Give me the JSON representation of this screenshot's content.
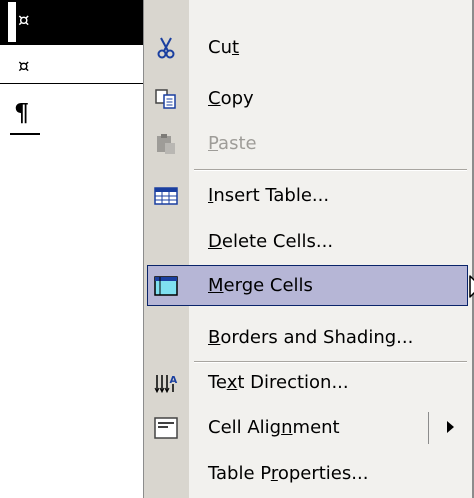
{
  "document": {
    "end_of_cell_mark": "¤",
    "paragraph_mark": "¶"
  },
  "menu": {
    "items": [
      {
        "label_pre": "Cu",
        "label_acc": "t",
        "label_post": "",
        "icon": "scissors-icon",
        "enabled": true
      },
      {
        "label_pre": "",
        "label_acc": "C",
        "label_post": "opy",
        "icon": "copy-icon",
        "enabled": true
      },
      {
        "label_pre": "",
        "label_acc": "P",
        "label_post": "aste",
        "icon": "paste-icon",
        "enabled": false
      },
      {
        "label_pre": "",
        "label_acc": "I",
        "label_post": "nsert Table...",
        "icon": "insert-table-icon",
        "enabled": true
      },
      {
        "label_pre": "",
        "label_acc": "D",
        "label_post": "elete Cells...",
        "icon": "",
        "enabled": true
      },
      {
        "label_pre": "",
        "label_acc": "M",
        "label_post": "erge Cells",
        "icon": "merge-cells-icon",
        "enabled": true,
        "highlighted": true
      },
      {
        "label_pre": "",
        "label_acc": "B",
        "label_post": "orders and Shading...",
        "icon": "",
        "enabled": true
      },
      {
        "label_pre": "Te",
        "label_acc": "x",
        "label_post": "t Direction...",
        "icon": "text-direction-icon",
        "enabled": true
      },
      {
        "label_pre": "Cell Alig",
        "label_acc": "n",
        "label_post": "ment",
        "icon": "cell-alignment-icon",
        "enabled": true,
        "submenu": true
      },
      {
        "label_pre": "Table P",
        "label_acc": "r",
        "label_post": "operties...",
        "icon": "",
        "enabled": true
      }
    ]
  },
  "colors": {
    "menu_bg": "#f2f1ee",
    "icon_strip": "#d9d6cf",
    "highlight_bg": "#b6b6d6",
    "highlight_border": "#0a246a",
    "disabled_text": "#9e9c98"
  }
}
